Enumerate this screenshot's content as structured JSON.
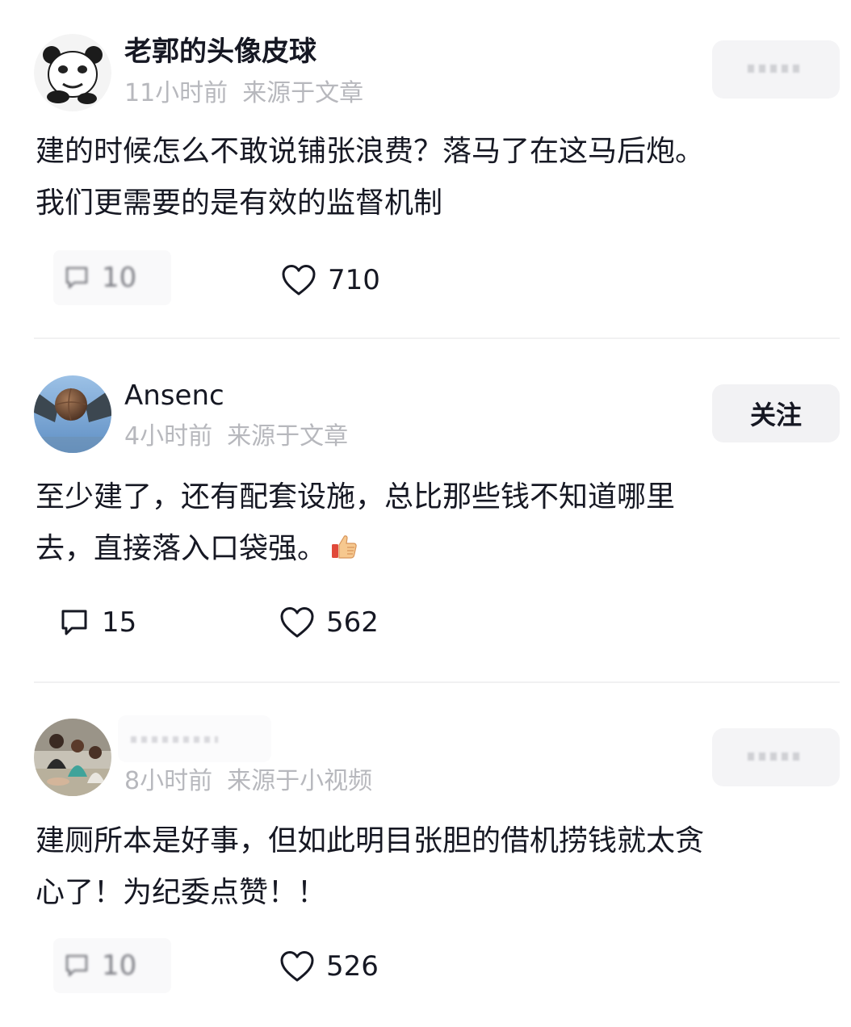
{
  "comments": [
    {
      "username": "老郭的头像皮球",
      "time": "11小时前",
      "source": "来源于文章",
      "text_lines": [
        "建的时候怎么不敢说铺张浪费？落马了在这马后炮。",
        "我们更需要的是有效的监督机制"
      ],
      "follow_label": "关注",
      "replies": "10",
      "likes": "710",
      "avatar": "panda-meme-avatar"
    },
    {
      "username": "Ansenc",
      "time": "4小时前",
      "source": "来源于文章",
      "text_lines": [
        "至少建了，还有配套设施，总比那些钱不知道哪里",
        "去，直接落入口袋强。"
      ],
      "emoji": "thumbs-up-emoji",
      "follow_label": "关注",
      "replies": "15",
      "likes": "562",
      "avatar": "ball-sculpture-avatar"
    },
    {
      "username": "",
      "time": "8小时前",
      "source": "来源于小视频",
      "text_lines": [
        "建厕所本是好事，但如此明目张胆的借机捞钱就太贪",
        "心了！为纪委点赞！！"
      ],
      "follow_label": "关注",
      "replies": "10",
      "likes": "526",
      "avatar": "group-photo-avatar"
    }
  ]
}
